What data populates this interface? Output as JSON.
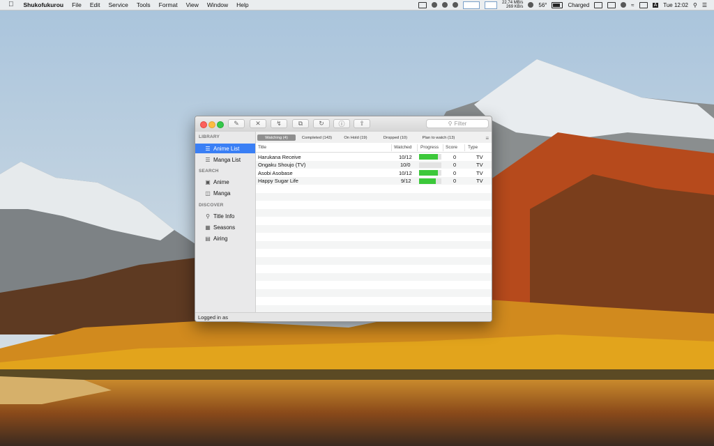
{
  "menubar": {
    "app_name": "Shukofukurou",
    "menus": [
      "File",
      "Edit",
      "Service",
      "Tools",
      "Format",
      "View",
      "Window",
      "Help"
    ],
    "net_up": "22.74 MB/s",
    "net_down": "269 KB/s",
    "temperature": "56°",
    "battery_label": "Charged",
    "input_source": "A",
    "clock": "Tue 12:02"
  },
  "window": {
    "filter_placeholder": "Filter",
    "toolbar_icons": [
      "edit-icon",
      "delete-icon",
      "share-link-icon",
      "copy-icon",
      "refresh-icon",
      "info-icon",
      "export-icon"
    ],
    "status_text": "Logged in as"
  },
  "sidebar": {
    "sections": [
      {
        "title": "LIBRARY",
        "items": [
          {
            "label": "Anime List",
            "icon": "list-icon",
            "selected": true
          },
          {
            "label": "Manga List",
            "icon": "list-icon"
          }
        ]
      },
      {
        "title": "SEARCH",
        "items": [
          {
            "label": "Anime",
            "icon": "tv-icon"
          },
          {
            "label": "Manga",
            "icon": "book-icon"
          }
        ]
      },
      {
        "title": "DISCOVER",
        "items": [
          {
            "label": "Title Info",
            "icon": "magnifier-icon"
          },
          {
            "label": "Seasons",
            "icon": "calendar-icon"
          },
          {
            "label": "Airing",
            "icon": "schedule-icon"
          }
        ]
      }
    ]
  },
  "tabs": [
    {
      "label": "Watching (4)",
      "active": true
    },
    {
      "label": "Completed (143)"
    },
    {
      "label": "On Hold (19)"
    },
    {
      "label": "Dropped (10)"
    },
    {
      "label": "Plan to watch (13)"
    }
  ],
  "table": {
    "columns": [
      "Title",
      "Watched",
      "Progress",
      "Score",
      "Type"
    ],
    "rows": [
      {
        "title": "Harukana Receive",
        "watched": "10/12",
        "progress": 0.83,
        "score": "0",
        "type": "TV"
      },
      {
        "title": "Ongaku Shoujo (TV)",
        "watched": "10/0",
        "progress": 0,
        "score": "0",
        "type": "TV"
      },
      {
        "title": "Asobi Asobase",
        "watched": "10/12",
        "progress": 0.83,
        "score": "0",
        "type": "TV"
      },
      {
        "title": "Happy Sugar Life",
        "watched": "9/12",
        "progress": 0.75,
        "score": "0",
        "type": "TV"
      }
    ]
  },
  "colors": {
    "selection": "#3a7ff5",
    "progress_fill": "#3cc83a"
  }
}
